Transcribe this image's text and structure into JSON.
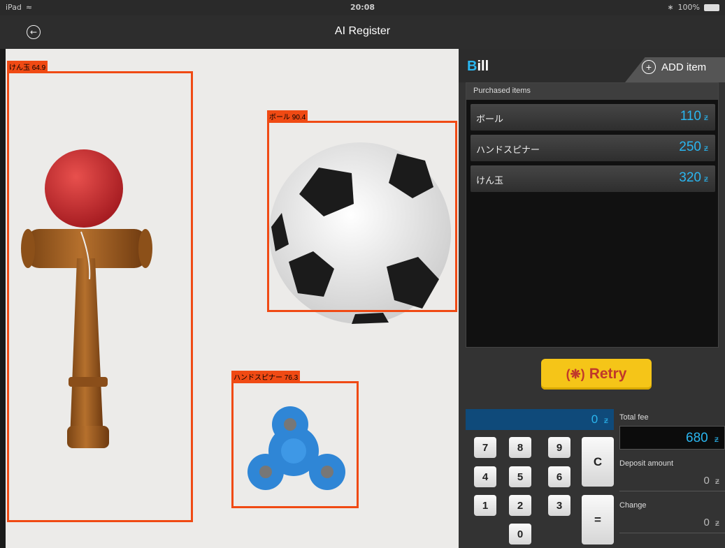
{
  "status": {
    "device": "iPad",
    "time": "20:08",
    "battery": "100%"
  },
  "nav": {
    "title": "AI Register"
  },
  "detections": [
    {
      "label": "けん玉 64.9"
    },
    {
      "label": "ボール 90.4"
    },
    {
      "label": "ハンドスピナー 76.3"
    }
  ],
  "bill": {
    "title_first": "B",
    "title_rest": "ill",
    "add_label": "ADD item",
    "items_header": "Purchased items",
    "currency": "ƶ",
    "items": [
      {
        "name": "ボール",
        "price": "110"
      },
      {
        "name": "ハンドスピナー",
        "price": "250"
      },
      {
        "name": "けん玉",
        "price": "320"
      }
    ]
  },
  "retry": {
    "label": "Retry"
  },
  "keypad": {
    "display": "0",
    "keys": [
      "7",
      "8",
      "9",
      "4",
      "5",
      "6",
      "1",
      "2",
      "3",
      "0"
    ],
    "clear": "C",
    "equals": "="
  },
  "totals": {
    "total_label": "Total fee",
    "total_value": "680",
    "deposit_label": "Deposit amount",
    "deposit_value": "0",
    "change_label": "Change",
    "change_value": "0"
  },
  "colors": {
    "accent": "#2ab6f0",
    "detect": "#f04a14",
    "retry": "#f5c518"
  }
}
